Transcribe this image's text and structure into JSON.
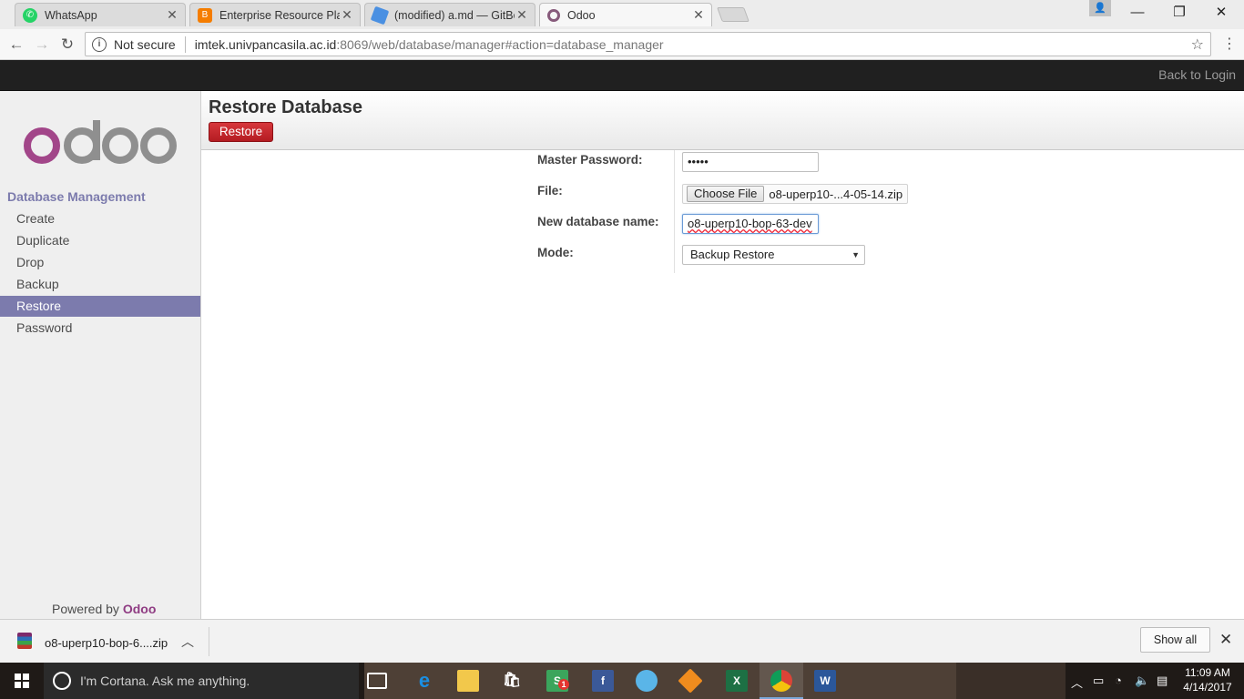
{
  "browser": {
    "tabs": [
      {
        "title": "WhatsApp",
        "icon": "whatsapp-icon",
        "color": "#25d366",
        "active": false
      },
      {
        "title": "Enterprise Resource Plann",
        "icon": "blogger-icon",
        "color": "#f57d00",
        "active": false
      },
      {
        "title": "(modified) a.md — GitBo",
        "icon": "gitbook-icon",
        "color": "#4a90e2",
        "active": false
      },
      {
        "title": "Odoo",
        "icon": "odoo-icon",
        "color": "#875a7b",
        "active": true
      }
    ],
    "address": {
      "security": "Not secure",
      "host": "imtek.univpancasila.ac.id",
      "path": ":8069/web/database/manager#action=database_manager"
    }
  },
  "topbar": {
    "back_to_login": "Back to Login"
  },
  "sidebar": {
    "section_title": "Database Management",
    "items": [
      {
        "label": "Create",
        "active": false
      },
      {
        "label": "Duplicate",
        "active": false
      },
      {
        "label": "Drop",
        "active": false
      },
      {
        "label": "Backup",
        "active": false
      },
      {
        "label": "Restore",
        "active": true
      },
      {
        "label": "Password",
        "active": false
      }
    ],
    "powered_by": "Powered by",
    "powered_brand": "Odoo"
  },
  "main": {
    "title": "Restore Database",
    "restore_button": "Restore",
    "form": {
      "master_password_label": "Master Password:",
      "master_password_value": "•••••",
      "file_label": "File:",
      "choose_file_button": "Choose File",
      "file_name": "o8-uperp10-...4-05-14.zip",
      "new_db_label": "New database name:",
      "new_db_value": "o8-uperp10-bop-63-dev",
      "mode_label": "Mode:",
      "mode_value": "Backup Restore"
    }
  },
  "downloads": {
    "file": "o8-uperp10-bop-6....zip",
    "show_all": "Show all"
  },
  "taskbar": {
    "cortana_placeholder": "I'm Cortana. Ask me anything.",
    "badge_count": "1",
    "time": "11:09 AM",
    "date": "4/14/2017"
  },
  "colors": {
    "odoo_purple": "#7c7bad",
    "restore_red": "#c9252b",
    "brand": "#8f3c83"
  }
}
